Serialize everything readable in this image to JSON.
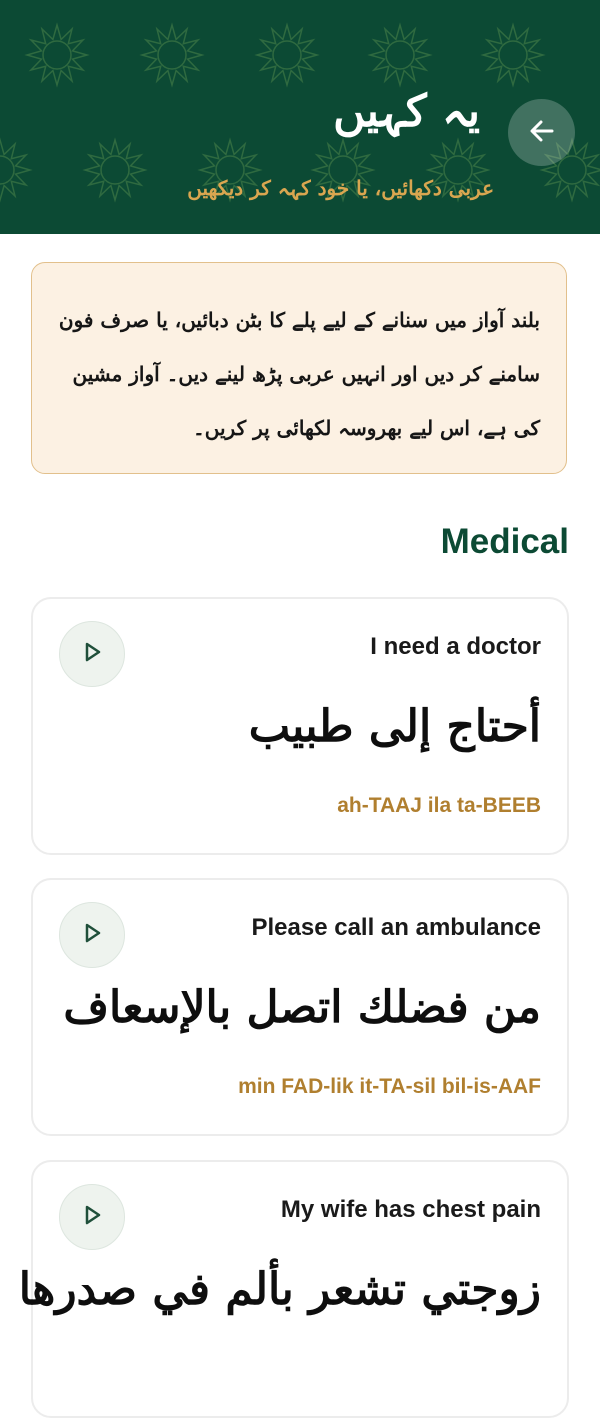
{
  "header": {
    "title": "یہ کہیں",
    "subtitle": "عربی دکھائیں، یا خود کہہ کر دیکھیں",
    "back_icon": "arrow-left-icon",
    "background_color": "#0c4a34",
    "accent_color": "#d9a650"
  },
  "info": {
    "text": "بلند آواز میں سنانے کے لیے پلے کا بٹن دبائیں، یا صرف فون سامنے کر دیں اور انہیں عربی پڑھ لینے دیں۔ آواز مشین کی ہے، اس لیے بھروسہ لکھائی پر کریں۔"
  },
  "section": {
    "title": "Medical"
  },
  "phrases": [
    {
      "english": "I need a doctor",
      "arabic": "أحتاج إلى طبيب",
      "transliteration": "ah-TAAJ ila ta-BEEB",
      "icon": "play-icon"
    },
    {
      "english": "Please call an ambulance",
      "arabic": "من فضلك اتصل بالإسعاف",
      "transliteration": "min FAD-lik it-TA-sil bil-is-AAF",
      "icon": "play-icon"
    },
    {
      "english": "My wife has chest pain",
      "arabic": "زوجتي تشعر بألم في صدرها",
      "transliteration": "",
      "icon": "play-icon"
    }
  ]
}
